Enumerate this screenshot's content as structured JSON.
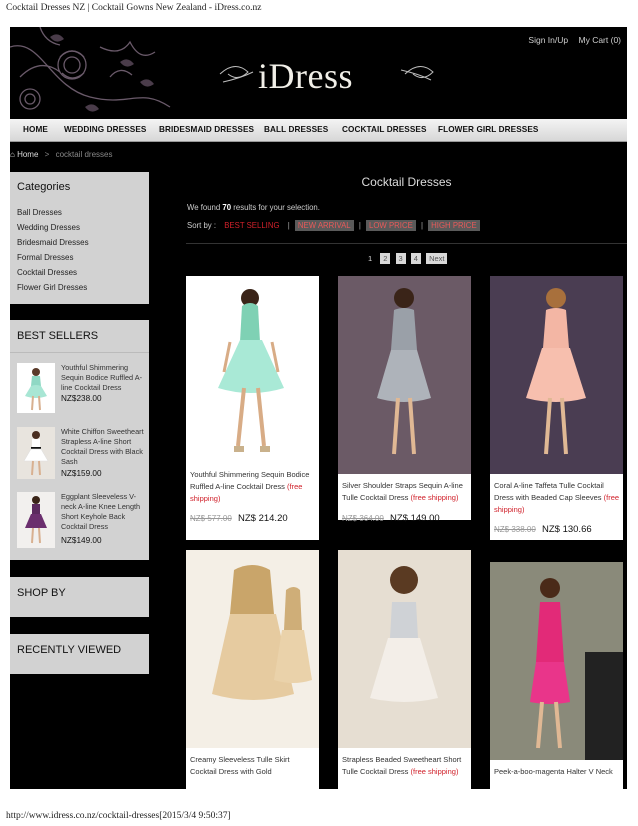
{
  "browser": {
    "page_title": "Cocktail Dresses NZ | Cocktail Gowns New Zealand - iDress.co.nz",
    "footer_url": "http://www.idress.co.nz/cocktail-dresses[2015/3/4 9:50:37]"
  },
  "header": {
    "logo_text": "iDress",
    "sign_in": "Sign In/Up",
    "cart_label": "My Cart (0)"
  },
  "nav": {
    "items": [
      "HOME",
      "WEDDING DRESSES",
      "BRIDESMAID DRESSES",
      "BALL DRESSES",
      "COCKTAIL DRESSES",
      "FLOWER GIRL DRESSES"
    ]
  },
  "breadcrumb": {
    "home": "Home",
    "separator": ">",
    "current": "cocktail dresses"
  },
  "sidebar": {
    "categories_title": "Categories",
    "categories": [
      "Ball Dresses",
      "Wedding Dresses",
      "Bridesmaid Dresses",
      "Formal Dresses",
      "Cocktail Dresses",
      "Flower Girl Dresses"
    ],
    "best_sellers_title": "BEST SELLERS",
    "best_sellers": [
      {
        "name": "Youthful Shimmering Sequin Bodice Ruffled A-line Cocktail Dress",
        "price": "NZ$238.00"
      },
      {
        "name": "White Chiffon Sweetheart Strapless A-line Short Cocktail Dress with Black Sash",
        "price": "NZ$159.00"
      },
      {
        "name": "Eggplant Sleeveless V-neck A-line Knee Length Short Keyhole Back Cocktail Dress",
        "price": "NZ$149.00"
      }
    ],
    "shop_by_title": "SHOP BY",
    "recently_viewed_title": "RECENTLY VIEWED"
  },
  "main": {
    "title": "Cocktail Dresses",
    "found_prefix": "We found",
    "found_count": "70",
    "found_suffix": "results for your selection.",
    "sort_label": "Sort by :",
    "sort_options": [
      "BEST SELLING",
      "NEW ARRIVAL",
      "LOW PRICE",
      "HIGH PRICE"
    ],
    "sort_separator": "|",
    "pager": [
      "1",
      "2",
      "3",
      "4",
      "Next"
    ]
  },
  "products": [
    {
      "name": "Youthful Shimmering Sequin Bodice Ruffled A-line Cocktail Dress",
      "shipping": "(free shipping)",
      "old_price": "NZ$ 577.00",
      "new_price": "NZ$ 214.20"
    },
    {
      "name": "Silver Shoulder Straps Sequin A-line Tulle Cocktail Dress",
      "shipping": "(free shipping)",
      "old_price": "NZ$ 364.00",
      "new_price": "NZ$ 149.00"
    },
    {
      "name": "Coral A-line Taffeta Tulle Cocktail Dress with Beaded Cap Sleeves",
      "shipping": "(free shipping)",
      "old_price": "NZ$ 338.00",
      "new_price": "NZ$ 130.66"
    },
    {
      "name": "Creamy Sleeveless Tulle Skirt Cocktail Dress with Gold",
      "shipping": "",
      "old_price": "",
      "new_price": ""
    },
    {
      "name": "Strapless Beaded Sweetheart Short Tulle Cocktail Dress",
      "shipping": "(free shipping)",
      "old_price": "",
      "new_price": ""
    },
    {
      "name": "Peek-a-boo-magenta Halter V Neck",
      "shipping": "",
      "old_price": "",
      "new_price": ""
    }
  ],
  "colors": {
    "page_bg": "#000000",
    "sidebar_box": "#d2d2d2",
    "accent_red": "#d0202a",
    "nav_bg": "#e6e6e6"
  }
}
